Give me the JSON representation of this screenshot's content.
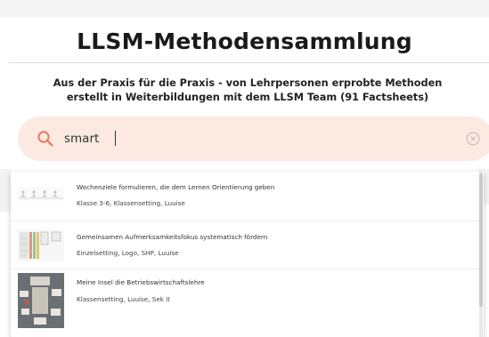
{
  "header": {
    "title": "LLSM-Methodensammlung",
    "subtitle": "Aus der Praxis für die Praxis - von Lehrpersonen erprobte Methoden erstellt in Weiterbildungen mit dem LLSM Team (91 Factsheets)"
  },
  "search": {
    "value": "smart",
    "icon": "search-icon",
    "clear_icon": "clear-icon"
  },
  "results": [
    {
      "title": "Wochenziele formulieren, die dem Lernen Orientierung geben",
      "meta": "Klasse 3-6, Klassensetting, Luuise"
    },
    {
      "title": "Gemeinsamen Aufmerksamkeitsfokus systematisch fördern",
      "meta": "Einzelsetting, Logo, SHP, Luuise"
    },
    {
      "title": "Meine Insel die Betriebswirtschaftslehre",
      "meta": "Klassensetting, Luuise, Sek II"
    }
  ],
  "colors": {
    "accent": "#e8795a",
    "search_bg": "#fbe9e2"
  }
}
